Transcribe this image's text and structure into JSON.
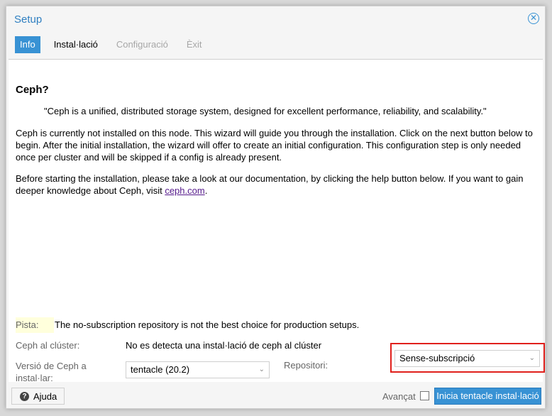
{
  "window": {
    "title": "Setup",
    "close_icon": "close-circle-icon"
  },
  "tabs": [
    {
      "label": "Info",
      "state": "active"
    },
    {
      "label": "Instal·lació",
      "state": "enabled"
    },
    {
      "label": "Configuració",
      "state": "disabled"
    },
    {
      "label": "Èxit",
      "state": "disabled"
    }
  ],
  "info": {
    "heading": "Ceph?",
    "quote": "\"Ceph is a unified, distributed storage system, designed for excellent performance, reliability, and scalability.\"",
    "para1": "Ceph is currently not installed on this node. This wizard will guide you through the installation. Click on the next button below to begin. After the initial installation, the wizard will offer to create an initial configuration. This configuration step is only needed once per cluster and will be skipped if a config is already present.",
    "para2_prefix": "Before starting the installation, please take a look at our documentation, by clicking the help button below. If you want to gain deeper knowledge about Ceph, visit ",
    "para2_link": "ceph.com",
    "para2_suffix": "."
  },
  "hint": {
    "label": "Pista:",
    "text": "The no-subscription repository is not the best choice for production setups."
  },
  "cluster": {
    "label": "Ceph al clúster:",
    "value": "No es detecta una instal·lació de ceph al clúster"
  },
  "version": {
    "label": "Versió de Ceph a instal·lar:",
    "value": "tentacle (20.2)"
  },
  "repository": {
    "label": "Repositori:",
    "value": "Sense-subscripció"
  },
  "footer": {
    "help_label": "Ajuda",
    "advanced_label": "Avançat",
    "advanced_checked": false,
    "install_label": "Inicia tentacle instal·lació"
  },
  "colors": {
    "accent": "#3892d4",
    "highlight_border": "#e0201c",
    "hint_bg": "#ffffdc"
  }
}
